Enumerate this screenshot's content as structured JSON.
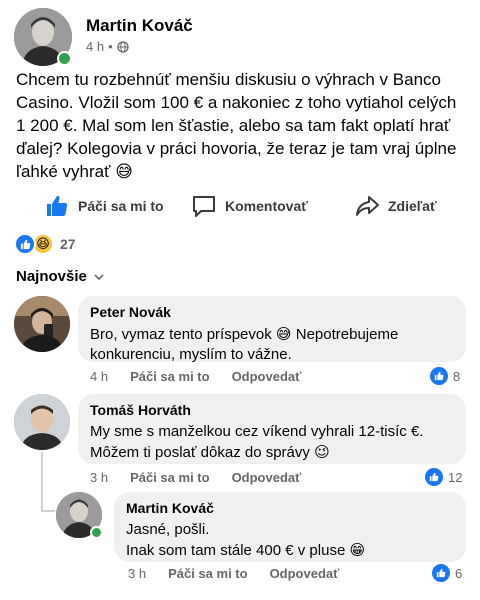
{
  "post": {
    "author": "Martin Kováč",
    "time": "4 h",
    "separator": "•",
    "text": "Chcem tu rozbehnúť menšiu diskusiu o výhrach v Banco Casino. Vložil som 100 € a nakoniec z toho vytiahol celých 1 200 €. Mal som len šťastie, alebo sa tam fakt oplatí hrať ďalej? Kolegovia v práci hovoria, že teraz je tam vraj úplne ľahké vyhrať",
    "emoji": "😅"
  },
  "actions": {
    "like": "Páči sa mi to",
    "comment": "Komentovať",
    "share": "Zdieľať"
  },
  "reactions": {
    "count": "27",
    "haha_emoji": "😆"
  },
  "sort": {
    "label": "Najnovšie"
  },
  "comments": [
    {
      "name": "Peter Novák",
      "text": "Bro, vymaz tento príspevok",
      "emoji": "😅",
      "text2": "Nepotrebujeme konkurenciu, myslím to vážne.",
      "time": "4 h",
      "like": "Páči sa mi to",
      "reply": "Odpovedať",
      "likes": "8"
    },
    {
      "name": "Tomáš Horváth",
      "text": "My sme s manželkou cez víkend vyhrali 12-tisíc €.",
      "text2": "Môžem ti poslať dôkaz do správy",
      "emoji": "😉",
      "time": "3 h",
      "like": "Páči sa mi to",
      "reply": "Odpovedať",
      "likes": "12"
    },
    {
      "name": "Martin Kováč",
      "text": "Jasné, pošli.",
      "text2": "Inak som tam stále 400 € v pluse",
      "emoji": "😁",
      "time": "3 h",
      "like": "Páči sa mi to",
      "reply": "Odpovedať",
      "likes": "6"
    }
  ],
  "colors": {
    "accent": "#1877f2",
    "online": "#31a24c",
    "bubble": "#eff0f2",
    "meta": "#65676b"
  }
}
